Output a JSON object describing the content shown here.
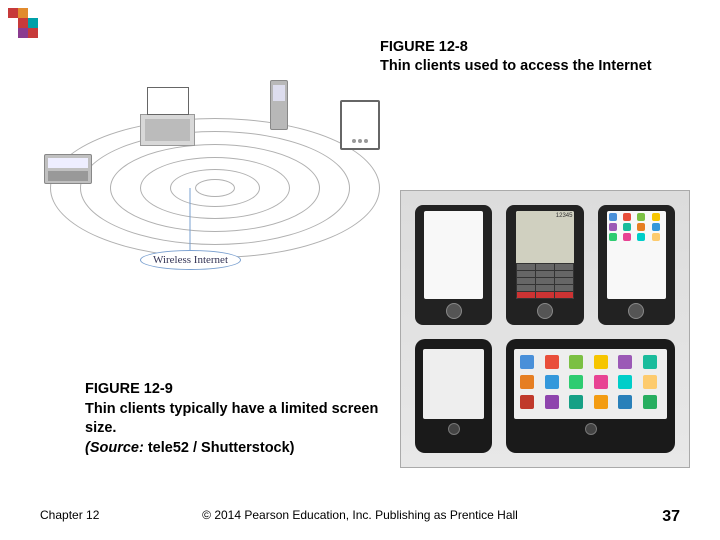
{
  "logo": {
    "colors": [
      "#c73a3a",
      "#e28b2d",
      "#00a0a8",
      "#8a3b8f"
    ]
  },
  "figure8": {
    "number": "FIGURE 12-8",
    "caption": "Thin clients used to access the Internet",
    "wireless_label": "Wireless Internet"
  },
  "figure9": {
    "number": "FIGURE 12-9",
    "caption": "Thin clients typically have a limited screen size.",
    "source_prefix": "(Source:",
    "source_text": " tele52 / Shutterstock)",
    "phone2_display": "12345"
  },
  "footer": {
    "chapter": "Chapter 12",
    "copyright": "© 2014 Pearson Education, Inc. Publishing as Prentice Hall",
    "page": "37"
  }
}
